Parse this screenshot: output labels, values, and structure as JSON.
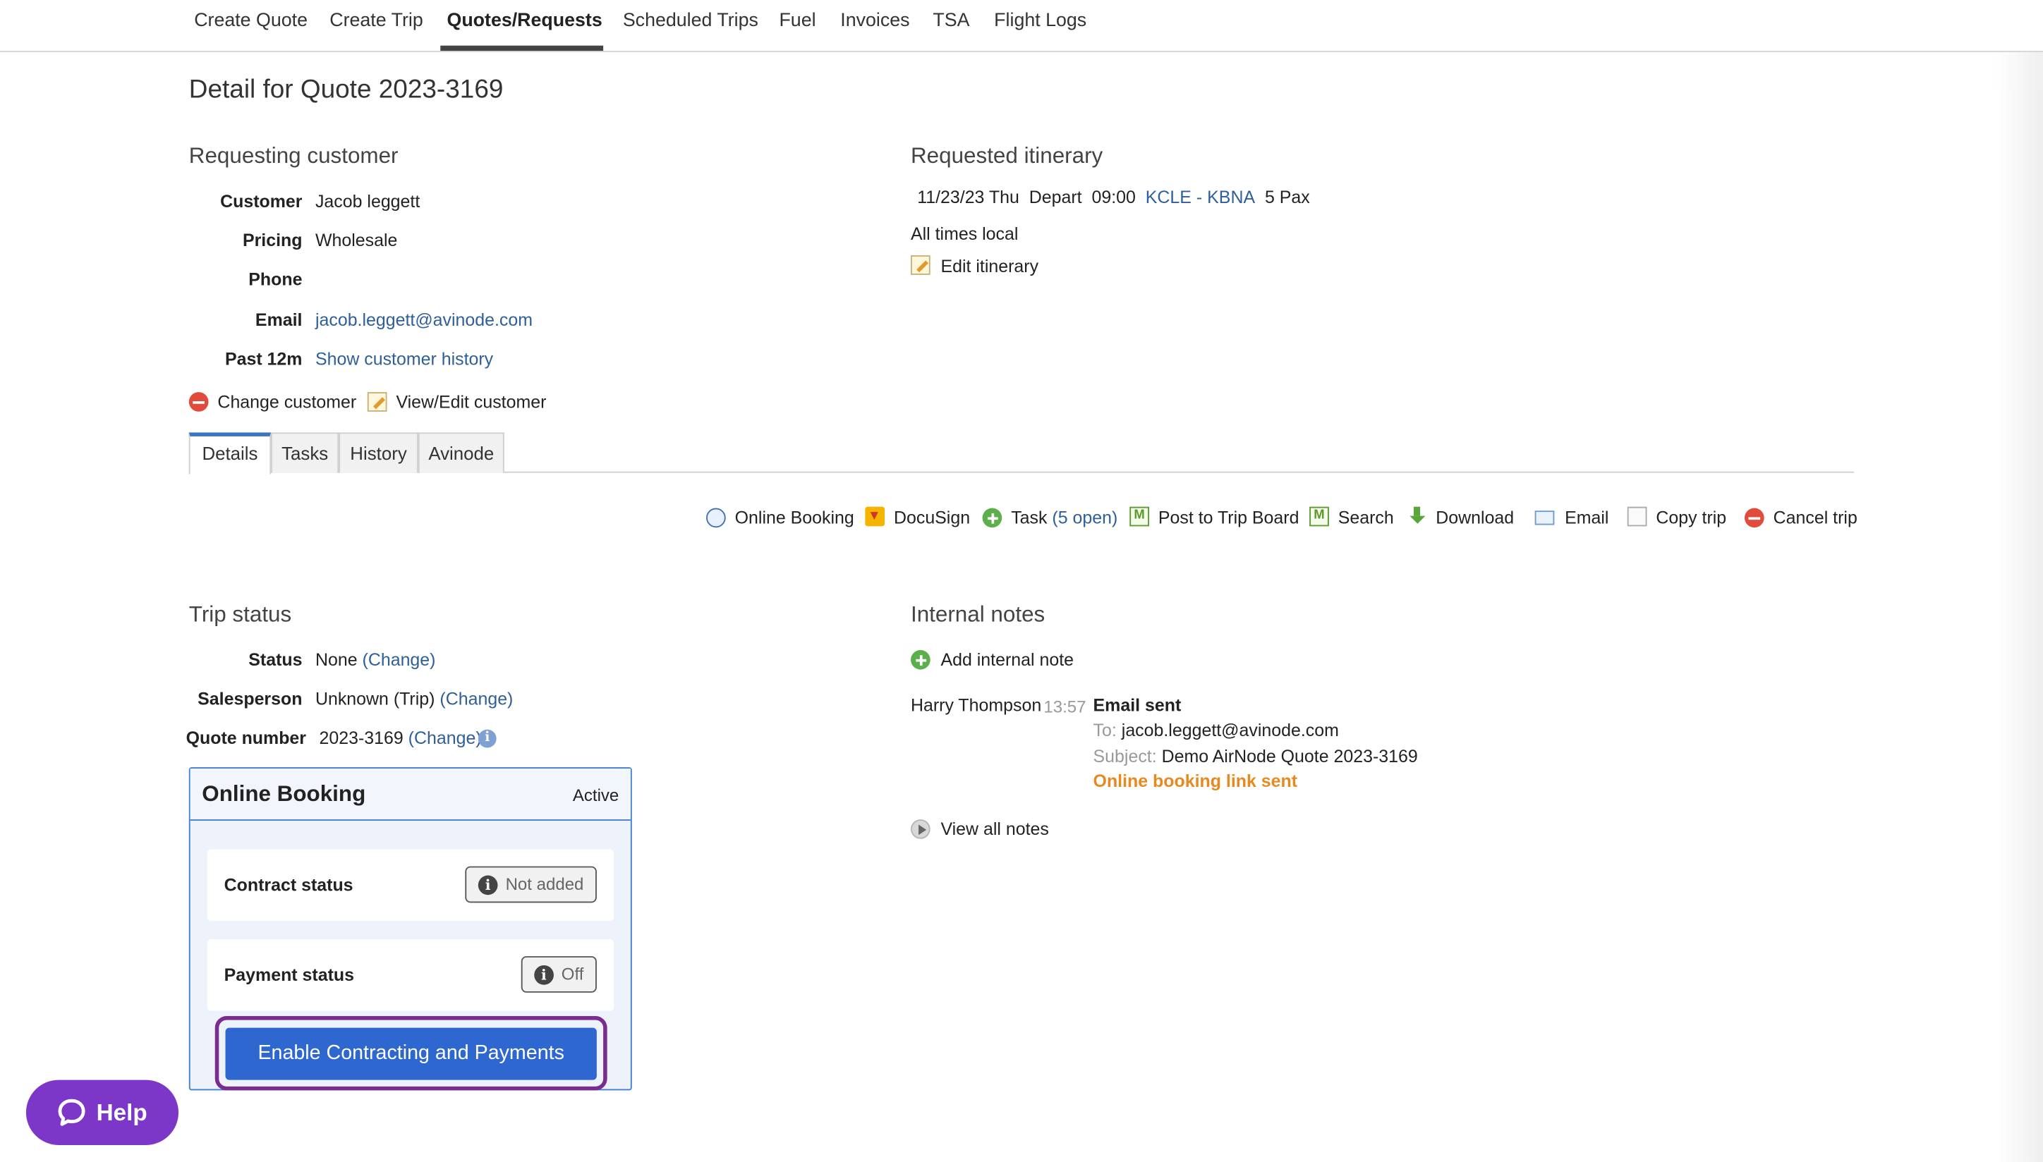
{
  "nav": {
    "items": [
      {
        "label": "Create Quote"
      },
      {
        "label": "Create Trip"
      },
      {
        "label": "Quotes/Requests"
      },
      {
        "label": "Scheduled Trips"
      },
      {
        "label": "Fuel"
      },
      {
        "label": "Invoices"
      },
      {
        "label": "TSA"
      },
      {
        "label": "Flight Logs"
      }
    ],
    "active": "Quotes/Requests"
  },
  "page": {
    "title": "Detail for Quote 2023-3169"
  },
  "customer": {
    "heading": "Requesting customer",
    "customer_label": "Customer",
    "customer_value": "Jacob leggett",
    "pricing_label": "Pricing",
    "pricing_value": "Wholesale",
    "phone_label": "Phone",
    "phone_value": "",
    "email_label": "Email",
    "email_value": "jacob.leggett@avinode.com",
    "past_label": "Past 12m",
    "past_value": "Show customer history",
    "change_label": "Change customer",
    "view_edit_label": "View/Edit customer"
  },
  "itinerary": {
    "heading": "Requested itinerary",
    "date": "11/23/23 Thu",
    "depart_label": "Depart",
    "time": "09:00",
    "from": "KCLE",
    "separator": "-",
    "to": "KBNA",
    "pax": "5 Pax",
    "times_note": "All times local",
    "edit_label": "Edit itinerary"
  },
  "tabs": [
    {
      "label": "Details",
      "active": true
    },
    {
      "label": "Tasks"
    },
    {
      "label": "History"
    },
    {
      "label": "Avinode"
    }
  ],
  "actions": {
    "online_booking": "Online Booking",
    "docusign": "DocuSign",
    "task": "Task",
    "task_open": "(5 open)",
    "post_trip_board": "Post to Trip Board",
    "search": "Search",
    "download": "Download",
    "email": "Email",
    "copy_trip": "Copy trip",
    "cancel_trip": "Cancel trip"
  },
  "trip_status": {
    "heading": "Trip status",
    "status_label": "Status",
    "status_value": "None",
    "salesperson_label": "Salesperson",
    "salesperson_value": "Unknown (Trip)",
    "quote_number_label": "Quote number",
    "quote_number_value": "2023-3169",
    "change_link": "(Change)"
  },
  "online_booking": {
    "title": "Online Booking",
    "state": "Active",
    "contract_label": "Contract status",
    "contract_value": "Not added",
    "payment_label": "Payment status",
    "payment_value": "Off",
    "enable_button": "Enable Contracting and Payments"
  },
  "notes": {
    "heading": "Internal notes",
    "add_label": "Add internal note",
    "entry": {
      "author": "Harry Thompson",
      "time": "13:57",
      "title": "Email sent",
      "to_label": "To:",
      "to_value": "jacob.leggett@avinode.com",
      "subject_label": "Subject:",
      "subject_value": "Demo AirNode Quote 2023-3169",
      "highlight": "Online booking link sent"
    },
    "view_all": "View all notes"
  },
  "help": {
    "label": "Help"
  },
  "colors": {
    "link": "#2e5f9a",
    "primary_button": "#2d67cf",
    "highlight_outline": "#7b2c8f",
    "help_button": "#7c37c9",
    "note_highlight": "#e8891f"
  }
}
